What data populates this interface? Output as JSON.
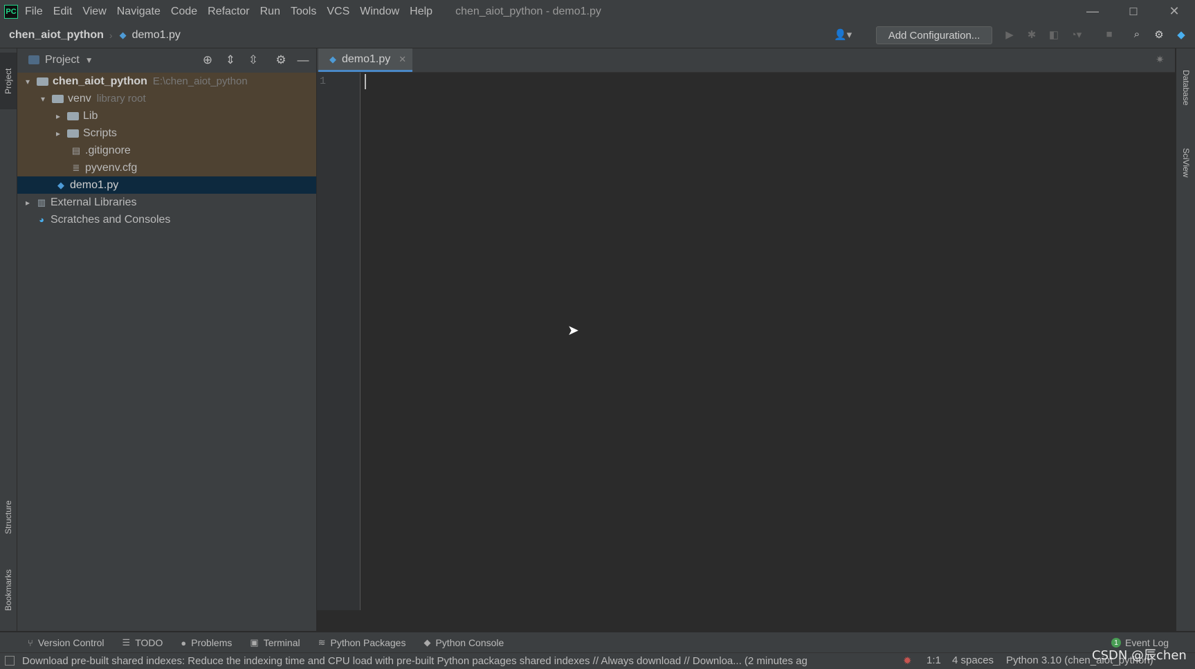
{
  "menu": [
    "File",
    "Edit",
    "View",
    "Navigate",
    "Code",
    "Refactor",
    "Run",
    "Tools",
    "VCS",
    "Window",
    "Help"
  ],
  "window_title": "chen_aiot_python - demo1.py",
  "window_controls": {
    "minimize": "—",
    "maximize": "☐",
    "close": "✕"
  },
  "breadcrumb": {
    "project": "chen_aiot_python",
    "file": "demo1.py"
  },
  "toolbar": {
    "add_config": "Add Configuration..."
  },
  "left_strip": {
    "project": "Project",
    "structure": "Structure",
    "bookmarks": "Bookmarks"
  },
  "project_panel": {
    "title": "Project",
    "tree": [
      {
        "label": "chen_aiot_python",
        "extra": "E:\\chen_aiot_python",
        "indent": 0,
        "arrow": "▾",
        "type": "folder",
        "bold": true
      },
      {
        "label": "venv",
        "extra": "library root",
        "indent": 1,
        "arrow": "▾",
        "type": "folder"
      },
      {
        "label": "Lib",
        "extra": "",
        "indent": 2,
        "arrow": "▸",
        "type": "folder"
      },
      {
        "label": "Scripts",
        "extra": "",
        "indent": 2,
        "arrow": "▸",
        "type": "folder"
      },
      {
        "label": ".gitignore",
        "extra": "",
        "indent": 2,
        "arrow": "",
        "type": "file"
      },
      {
        "label": "pyvenv.cfg",
        "extra": "",
        "indent": 2,
        "arrow": "",
        "type": "file"
      },
      {
        "label": "demo1.py",
        "extra": "",
        "indent": 1,
        "arrow": "",
        "type": "py"
      },
      {
        "label": "External Libraries",
        "extra": "",
        "indent": 0,
        "arrow": "▸",
        "type": "lib"
      },
      {
        "label": "Scratches and Consoles",
        "extra": "",
        "indent": 0,
        "arrow": "",
        "type": "scratch"
      }
    ]
  },
  "editor": {
    "tab": "demo1.py",
    "line_number": "1"
  },
  "right_strip": {
    "database": "Database",
    "sciview": "SciView"
  },
  "tool_windows": [
    {
      "label": "Version Control",
      "icon": "branch-icon"
    },
    {
      "label": "TODO",
      "icon": "list-icon"
    },
    {
      "label": "Problems",
      "icon": "info-icon"
    },
    {
      "label": "Terminal",
      "icon": "terminal-icon"
    },
    {
      "label": "Python Packages",
      "icon": "layers-icon"
    },
    {
      "label": "Python Console",
      "icon": "python-icon"
    }
  ],
  "event_log": {
    "label": "Event Log",
    "count": "1"
  },
  "status": {
    "message": "Download pre-built shared indexes: Reduce the indexing time and CPU load with pre-built Python packages shared indexes // Always download // Downloa... (2 minutes ag",
    "position": "1:1",
    "indent": "4 spaces",
    "interpreter": "Python 3.10 (chen_aiot_python)"
  },
  "watermark": "CSDN @辰chen"
}
